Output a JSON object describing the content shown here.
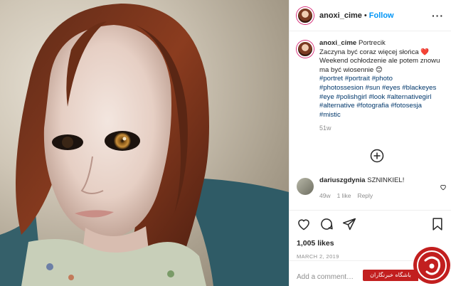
{
  "header": {
    "username": "anoxi_cime",
    "separator": "•",
    "follow_label": "Follow",
    "more_label": "···"
  },
  "caption": {
    "username": "anoxi_cime",
    "lines": [
      "Portrecik",
      "Zaczyna być coraz więcej słońca ❤️",
      "Weekend ochłodzenie ale potem znowu",
      "ma być wiosennie 😊"
    ],
    "hashtag_lines": [
      "#portret #portrait #photo",
      "#photossesion #sun #eyes #blackeyes",
      "#eye #polishgirl #look #alternativegirl",
      "#alternative #fotografia #fotosesja",
      "#mistic"
    ],
    "age": "51w"
  },
  "load_more_icon": "plus-circle-icon",
  "comment": {
    "username": "dariuszgdynia",
    "text": "SZNINKIEL!",
    "age": "49w",
    "likes": "1 like",
    "reply_label": "Reply"
  },
  "actions": {
    "icons": [
      "heart-icon",
      "comment-icon",
      "share-icon",
      "bookmark-icon"
    ],
    "likes_label": "1,005 likes",
    "date_label": "MARCH 2, 2019"
  },
  "add_comment": {
    "placeholder": "Add a comment…"
  },
  "watermark": {
    "text": "باشگاه خبرنگاران"
  },
  "colors": {
    "text": "#262626",
    "muted": "#8e8e8e",
    "link": "#00376b",
    "follow": "#0095f6",
    "watermark": "#c21f1f"
  }
}
